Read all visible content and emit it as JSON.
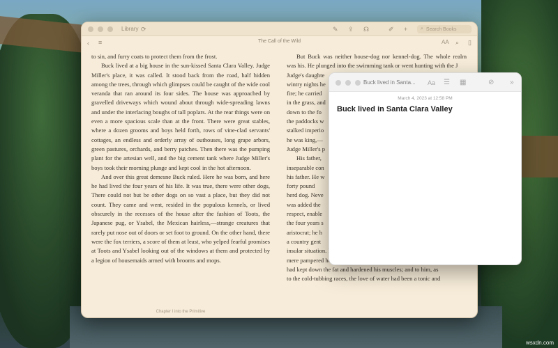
{
  "books": {
    "library_label": "Library",
    "search_placeholder": "Search Books",
    "book_title": "The Call of the Wild",
    "left_page": [
      "to sin, and furry coats to protect them from the frost.",
      "Buck lived at a big house in the sun-kissed Santa Clara Valley. Judge Miller's place, it was called. It stood back from the road, half hidden among the trees, through which glimpses could be caught of the wide cool veranda that ran around its four sides. The house was approached by gravelled driveways which wound about through wide-spreading lawns and under the interlacing boughs of tall poplars. At the rear things were on even a more spacious scale than at the front. There were great stables, where a dozen grooms and boys held forth, rows of vine-clad servants' cottages, an endless and orderly array of outhouses, long grape arbors, green pastures, orchards, and berry patches. Then there was the pumping plant for the artesian well, and the big cement tank where Judge Miller's boys took their morning plunge and kept cool in the hot afternoon.",
      "And over this great demesne Buck ruled. Here he was born, and here he had lived the four years of his life. It was true, there were other dogs, There could not but be other dogs on so vast a place, but they did not count. They came and went, resided in the populous kennels, or lived obscurely in the recesses of the house after the fashion of Toots, the Japanese pug, or Ysabel, the Mexican hairless,—strange creatures that rarely put nose out of doors or set foot to ground. On the other hand, there were the fox terriers, a score of them at least, who yelped fearful promises at Toots and Ysabel looking out of the windows at them and protected by a legion of housemaids armed with brooms and mops."
    ],
    "right_page": [
      "But Buck was neither house-dog nor kennel-dog. The whole realm was his. He plunged into the swimming tank or went hunting with the J",
      "Judge's daughte",
      "wintry nights he",
      "fire; he carried",
      "in the grass, and",
      "down to the fo",
      "the paddocks w",
      "stalked imperio",
      "he was king,—",
      "Judge Miller's p",
      "His father,",
      "inseparable con",
      "his father. He w",
      "forty pound",
      "herd dog. Neve",
      "was added the",
      "respect, enable",
      "the four years s",
      "aristocrat; he h",
      "a country gent",
      "insular situation. But he had saved himself by not becoming a",
      "mere pampered house-dog. Hunting and kindred outdoor delights",
      "had kept down the fat and hardened his muscles; and to him, as",
      "to the cold-tubbing races, the love of water had been a tonic and"
    ],
    "chapter_footer": "Chapter I into the Primitive"
  },
  "notes": {
    "window_title": "Buck lived in Santa...",
    "date": "March 4, 2023 at 12:58 PM",
    "heading": "Buck lived in Santa Clara Valley"
  },
  "watermark": "wsxdn.com"
}
